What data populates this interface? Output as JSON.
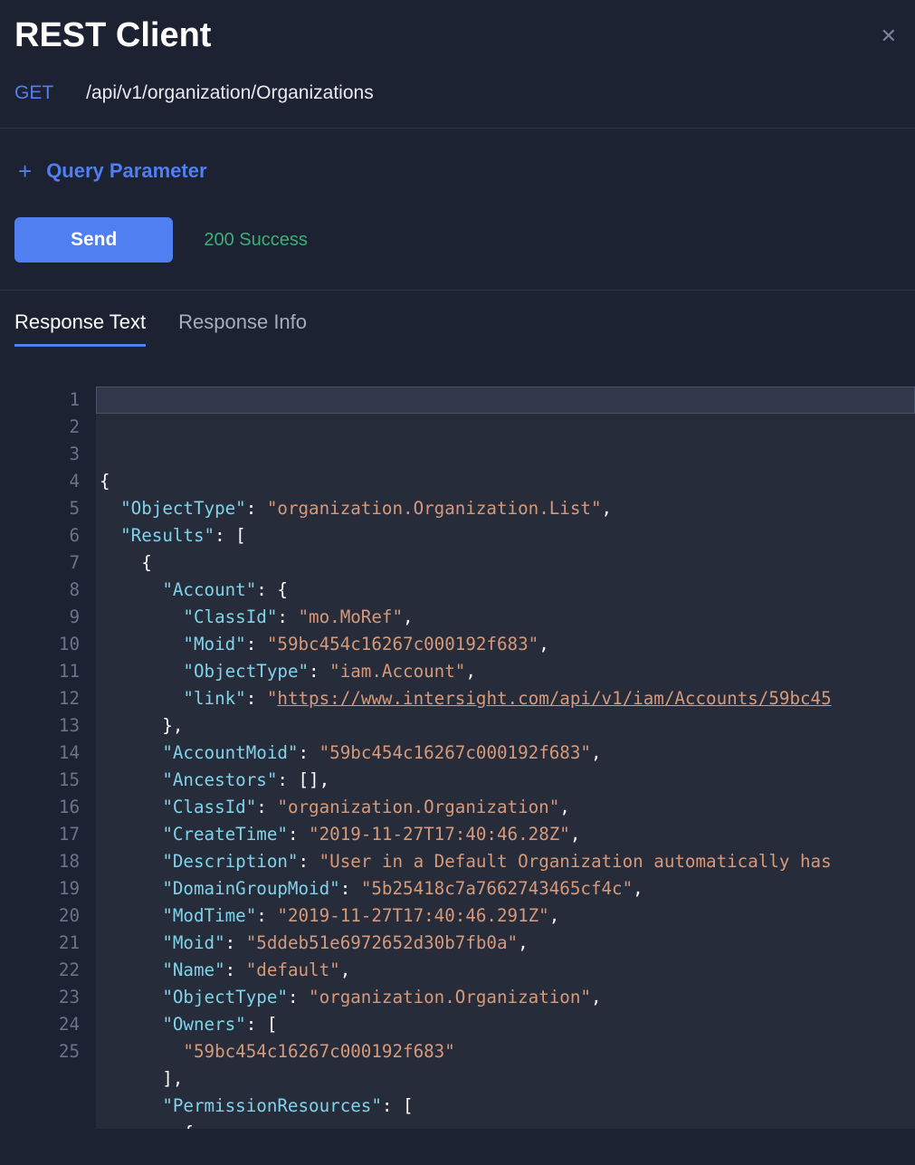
{
  "title": "REST Client",
  "request": {
    "method": "GET",
    "url": "/api/v1/organization/Organizations"
  },
  "queryParamLabel": "Query Parameter",
  "sendLabel": "Send",
  "status": "200 Success",
  "tabs": {
    "responseText": "Response Text",
    "responseInfo": "Response Info"
  },
  "response": {
    "ObjectType": "organization.Organization.List",
    "Results": [
      {
        "Account": {
          "ClassId": "mo.MoRef",
          "Moid": "59bc454c16267c000192f683",
          "ObjectType": "iam.Account",
          "link": "https://www.intersight.com/api/v1/iam/Accounts/59bc45"
        },
        "AccountMoid": "59bc454c16267c000192f683",
        "Ancestors": [],
        "ClassId": "organization.Organization",
        "CreateTime": "2019-11-27T17:40:46.28Z",
        "Description": "User in a Default Organization automatically has",
        "DomainGroupMoid": "5b25418c7a7662743465cf4c",
        "ModTime": "2019-11-27T17:40:46.291Z",
        "Moid": "5ddeb51e6972652d30b7fb0a",
        "Name": "default",
        "ObjectType": "organization.Organization",
        "Owners": [
          "59bc454c16267c000192f683"
        ],
        "PermissionResources": [
          {}
        ]
      }
    ]
  },
  "codeLines": [
    {
      "n": 1,
      "segs": [
        {
          "t": "{",
          "c": "p"
        }
      ]
    },
    {
      "n": 2,
      "segs": [
        {
          "t": "  ",
          "c": "p"
        },
        {
          "t": "\"ObjectType\"",
          "c": "k"
        },
        {
          "t": ": ",
          "c": "p"
        },
        {
          "t": "\"organization.Organization.List\"",
          "c": "s"
        },
        {
          "t": ",",
          "c": "p"
        }
      ]
    },
    {
      "n": 3,
      "segs": [
        {
          "t": "  ",
          "c": "p"
        },
        {
          "t": "\"Results\"",
          "c": "k"
        },
        {
          "t": ": [",
          "c": "p"
        }
      ]
    },
    {
      "n": 4,
      "segs": [
        {
          "t": "    {",
          "c": "p"
        }
      ]
    },
    {
      "n": 5,
      "segs": [
        {
          "t": "      ",
          "c": "p"
        },
        {
          "t": "\"Account\"",
          "c": "k"
        },
        {
          "t": ": {",
          "c": "p"
        }
      ]
    },
    {
      "n": 6,
      "segs": [
        {
          "t": "        ",
          "c": "p"
        },
        {
          "t": "\"ClassId\"",
          "c": "k"
        },
        {
          "t": ": ",
          "c": "p"
        },
        {
          "t": "\"mo.MoRef\"",
          "c": "s"
        },
        {
          "t": ",",
          "c": "p"
        }
      ]
    },
    {
      "n": 7,
      "segs": [
        {
          "t": "        ",
          "c": "p"
        },
        {
          "t": "\"Moid\"",
          "c": "k"
        },
        {
          "t": ": ",
          "c": "p"
        },
        {
          "t": "\"59bc454c16267c000192f683\"",
          "c": "s"
        },
        {
          "t": ",",
          "c": "p"
        }
      ]
    },
    {
      "n": 8,
      "segs": [
        {
          "t": "        ",
          "c": "p"
        },
        {
          "t": "\"ObjectType\"",
          "c": "k"
        },
        {
          "t": ": ",
          "c": "p"
        },
        {
          "t": "\"iam.Account\"",
          "c": "s"
        },
        {
          "t": ",",
          "c": "p"
        }
      ]
    },
    {
      "n": 9,
      "segs": [
        {
          "t": "        ",
          "c": "p"
        },
        {
          "t": "\"link\"",
          "c": "k"
        },
        {
          "t": ": ",
          "c": "p"
        },
        {
          "t": "\"",
          "c": "s"
        },
        {
          "t": "https://www.intersight.com/api/v1/iam/Accounts/59bc45",
          "c": "lnk"
        }
      ]
    },
    {
      "n": 10,
      "segs": [
        {
          "t": "      },",
          "c": "p"
        }
      ]
    },
    {
      "n": 11,
      "segs": [
        {
          "t": "      ",
          "c": "p"
        },
        {
          "t": "\"AccountMoid\"",
          "c": "k"
        },
        {
          "t": ": ",
          "c": "p"
        },
        {
          "t": "\"59bc454c16267c000192f683\"",
          "c": "s"
        },
        {
          "t": ",",
          "c": "p"
        }
      ]
    },
    {
      "n": 12,
      "segs": [
        {
          "t": "      ",
          "c": "p"
        },
        {
          "t": "\"Ancestors\"",
          "c": "k"
        },
        {
          "t": ": [],",
          "c": "p"
        }
      ]
    },
    {
      "n": 13,
      "segs": [
        {
          "t": "      ",
          "c": "p"
        },
        {
          "t": "\"ClassId\"",
          "c": "k"
        },
        {
          "t": ": ",
          "c": "p"
        },
        {
          "t": "\"organization.Organization\"",
          "c": "s"
        },
        {
          "t": ",",
          "c": "p"
        }
      ]
    },
    {
      "n": 14,
      "segs": [
        {
          "t": "      ",
          "c": "p"
        },
        {
          "t": "\"CreateTime\"",
          "c": "k"
        },
        {
          "t": ": ",
          "c": "p"
        },
        {
          "t": "\"2019-11-27T17:40:46.28Z\"",
          "c": "s"
        },
        {
          "t": ",",
          "c": "p"
        }
      ]
    },
    {
      "n": 15,
      "segs": [
        {
          "t": "      ",
          "c": "p"
        },
        {
          "t": "\"Description\"",
          "c": "k"
        },
        {
          "t": ": ",
          "c": "p"
        },
        {
          "t": "\"User in a Default Organization automatically has",
          "c": "s"
        }
      ]
    },
    {
      "n": 16,
      "segs": [
        {
          "t": "      ",
          "c": "p"
        },
        {
          "t": "\"DomainGroupMoid\"",
          "c": "k"
        },
        {
          "t": ": ",
          "c": "p"
        },
        {
          "t": "\"5b25418c7a7662743465cf4c\"",
          "c": "s"
        },
        {
          "t": ",",
          "c": "p"
        }
      ]
    },
    {
      "n": 17,
      "segs": [
        {
          "t": "      ",
          "c": "p"
        },
        {
          "t": "\"ModTime\"",
          "c": "k"
        },
        {
          "t": ": ",
          "c": "p"
        },
        {
          "t": "\"2019-11-27T17:40:46.291Z\"",
          "c": "s"
        },
        {
          "t": ",",
          "c": "p"
        }
      ]
    },
    {
      "n": 18,
      "segs": [
        {
          "t": "      ",
          "c": "p"
        },
        {
          "t": "\"Moid\"",
          "c": "k"
        },
        {
          "t": ": ",
          "c": "p"
        },
        {
          "t": "\"5ddeb51e6972652d30b7fb0a\"",
          "c": "s"
        },
        {
          "t": ",",
          "c": "p"
        }
      ]
    },
    {
      "n": 19,
      "segs": [
        {
          "t": "      ",
          "c": "p"
        },
        {
          "t": "\"Name\"",
          "c": "k"
        },
        {
          "t": ": ",
          "c": "p"
        },
        {
          "t": "\"default\"",
          "c": "s"
        },
        {
          "t": ",",
          "c": "p"
        }
      ]
    },
    {
      "n": 20,
      "segs": [
        {
          "t": "      ",
          "c": "p"
        },
        {
          "t": "\"ObjectType\"",
          "c": "k"
        },
        {
          "t": ": ",
          "c": "p"
        },
        {
          "t": "\"organization.Organization\"",
          "c": "s"
        },
        {
          "t": ",",
          "c": "p"
        }
      ]
    },
    {
      "n": 21,
      "segs": [
        {
          "t": "      ",
          "c": "p"
        },
        {
          "t": "\"Owners\"",
          "c": "k"
        },
        {
          "t": ": [",
          "c": "p"
        }
      ]
    },
    {
      "n": 22,
      "segs": [
        {
          "t": "        ",
          "c": "p"
        },
        {
          "t": "\"59bc454c16267c000192f683\"",
          "c": "s"
        }
      ]
    },
    {
      "n": 23,
      "segs": [
        {
          "t": "      ],",
          "c": "p"
        }
      ]
    },
    {
      "n": 24,
      "segs": [
        {
          "t": "      ",
          "c": "p"
        },
        {
          "t": "\"PermissionResources\"",
          "c": "k"
        },
        {
          "t": ": [",
          "c": "p"
        }
      ]
    },
    {
      "n": 25,
      "segs": [
        {
          "t": "        {",
          "c": "p"
        }
      ]
    }
  ]
}
